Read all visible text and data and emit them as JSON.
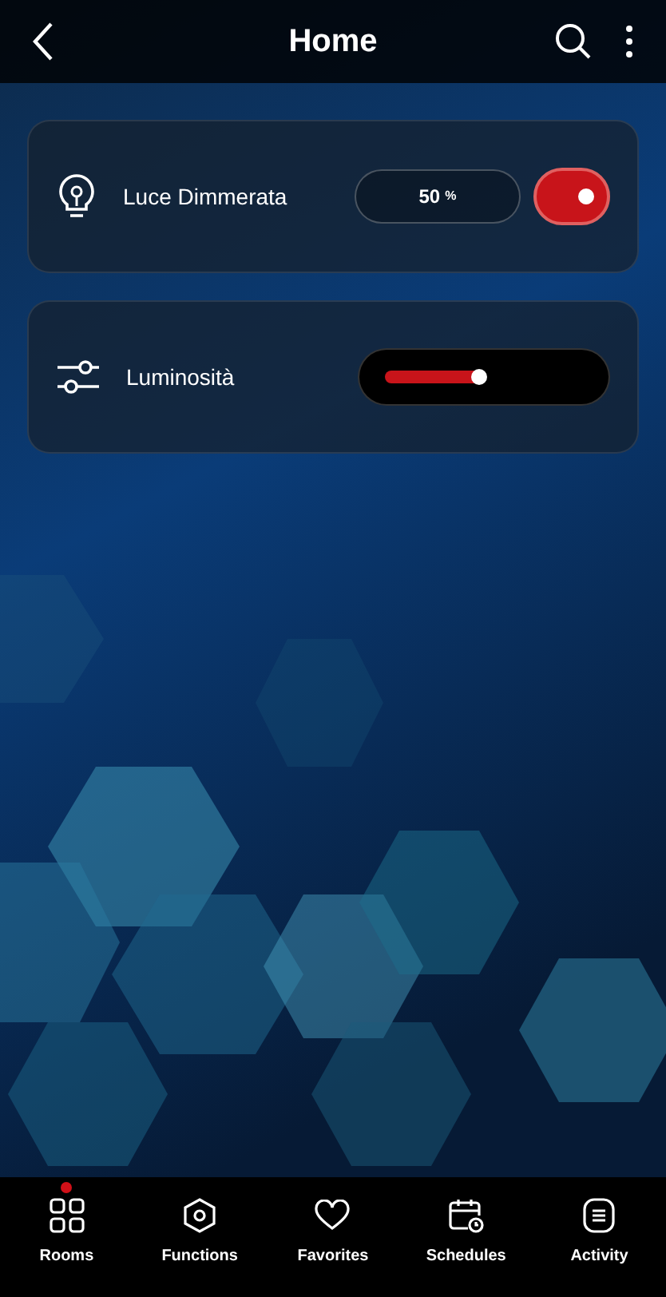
{
  "header": {
    "title": "Home"
  },
  "devices": [
    {
      "kind": "toggle",
      "name": "Luce Dimmerata",
      "value": "50",
      "unit": "%",
      "on": true
    },
    {
      "kind": "slider",
      "name": "Luminosità"
    }
  ],
  "nav": [
    {
      "label": "Rooms",
      "selected": true
    },
    {
      "label": "Functions",
      "selected": false
    },
    {
      "label": "Favorites",
      "selected": false
    },
    {
      "label": "Schedules",
      "selected": false
    },
    {
      "label": "Activity",
      "selected": false
    }
  ]
}
